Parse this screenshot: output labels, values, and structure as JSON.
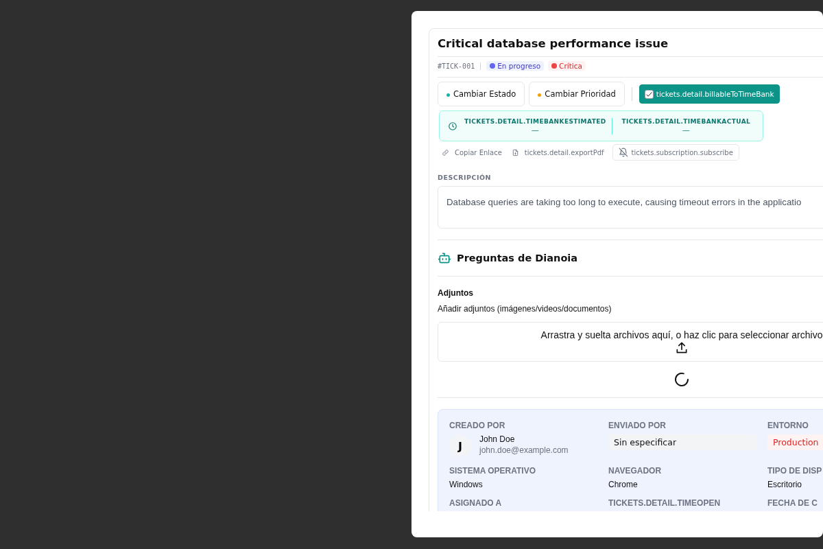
{
  "ticket": {
    "title": "Critical database performance issue",
    "id": "#TICK-001",
    "badges": [
      {
        "label": "En progreso",
        "color": "#6366f1",
        "kind": "status"
      },
      {
        "label": "Crítica",
        "color": "#ef4444",
        "kind": "priority"
      }
    ]
  },
  "actions": [
    {
      "label": "Cambiar Estado",
      "color": "#14b8a6"
    },
    {
      "label": "Cambiar Prioridad",
      "color": "#f59e0b"
    }
  ],
  "billable": {
    "label": "tickets.detail.billableToTimeBank",
    "checked": true
  },
  "timebank": [
    {
      "label": "TICKETS.DETAIL.TIMEBANKESTIMATED",
      "value": "—"
    },
    {
      "label": "TICKETS.DETAIL.TIMEBANKACTUAL",
      "value": "—"
    }
  ],
  "links": [
    {
      "label": "Copiar Enlace",
      "kind": "link"
    },
    {
      "label": "tickets.detail.exportPdf",
      "kind": "file"
    },
    {
      "label": "tickets.subscription.subscribe",
      "kind": "bell"
    }
  ],
  "description": {
    "heading": "DESCRIPCIÓN",
    "text": "Database queries are taking too long to execute, causing timeout errors in the applicatio"
  },
  "assistant": {
    "title": "Preguntas de Dianoia"
  },
  "attachments": {
    "heading": "Adjuntos",
    "hint": "Añadir adjuntos (imágenes/videos/documentos)",
    "dropzone": "Arrastra y suelta archivos aquí, o haz clic para seleccionar archivo",
    "loading": true
  },
  "details": [
    {
      "label": "CREADO POR",
      "kind": "user",
      "avatar": "J",
      "name": "John Doe",
      "email": "john.doe@example.com"
    },
    {
      "label": "ENVIADO POR",
      "kind": "field",
      "value": "Sin especificar"
    },
    {
      "label": "ENTORNO",
      "kind": "tag",
      "value": "Production"
    },
    {
      "label": "SISTEMA OPERATIVO",
      "kind": "text",
      "value": "Windows"
    },
    {
      "label": "NAVEGADOR",
      "kind": "text",
      "value": "Chrome"
    },
    {
      "label": "TIPO DE DISP",
      "kind": "text",
      "value": "Escritorio"
    },
    {
      "label": "ASIGNADO A",
      "kind": "text"
    },
    {
      "label": "TICKETS.DETAIL.TIMEOPEN",
      "kind": "text"
    },
    {
      "label": "FECHA DE C",
      "kind": "text"
    }
  ]
}
